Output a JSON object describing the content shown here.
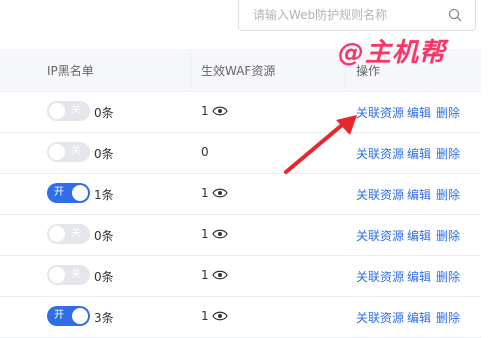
{
  "search": {
    "placeholder": "请输入Web防护规则名称",
    "icon": "search-icon"
  },
  "columns": {
    "blacklist": "IP黑名单",
    "waf": "生效WAF资源",
    "actions": "操作"
  },
  "watermark": "@主机帮",
  "accent_color": "#2f6ee8",
  "arrow_color": "#e8262c",
  "rows": [
    {
      "toggle": "关",
      "enabled": false,
      "count": "0条",
      "waf": "1",
      "has_eye": true,
      "actions": [
        "关联资源",
        "编辑",
        "删除"
      ]
    },
    {
      "toggle": "关",
      "enabled": false,
      "count": "0条",
      "waf": "0",
      "has_eye": false,
      "actions": [
        "关联资源",
        "编辑",
        "删除"
      ]
    },
    {
      "toggle": "开",
      "enabled": true,
      "count": "1条",
      "waf": "1",
      "has_eye": true,
      "actions": [
        "关联资源",
        "编辑",
        "删除"
      ]
    },
    {
      "toggle": "关",
      "enabled": false,
      "count": "0条",
      "waf": "1",
      "has_eye": true,
      "actions": [
        "关联资源",
        "编辑",
        "删除"
      ]
    },
    {
      "toggle": "关",
      "enabled": false,
      "count": "0条",
      "waf": "1",
      "has_eye": true,
      "actions": [
        "关联资源",
        "编辑",
        "删除"
      ]
    },
    {
      "toggle": "开",
      "enabled": true,
      "count": "3条",
      "waf": "1",
      "has_eye": true,
      "actions": [
        "关联资源",
        "编辑",
        "删除"
      ]
    }
  ]
}
